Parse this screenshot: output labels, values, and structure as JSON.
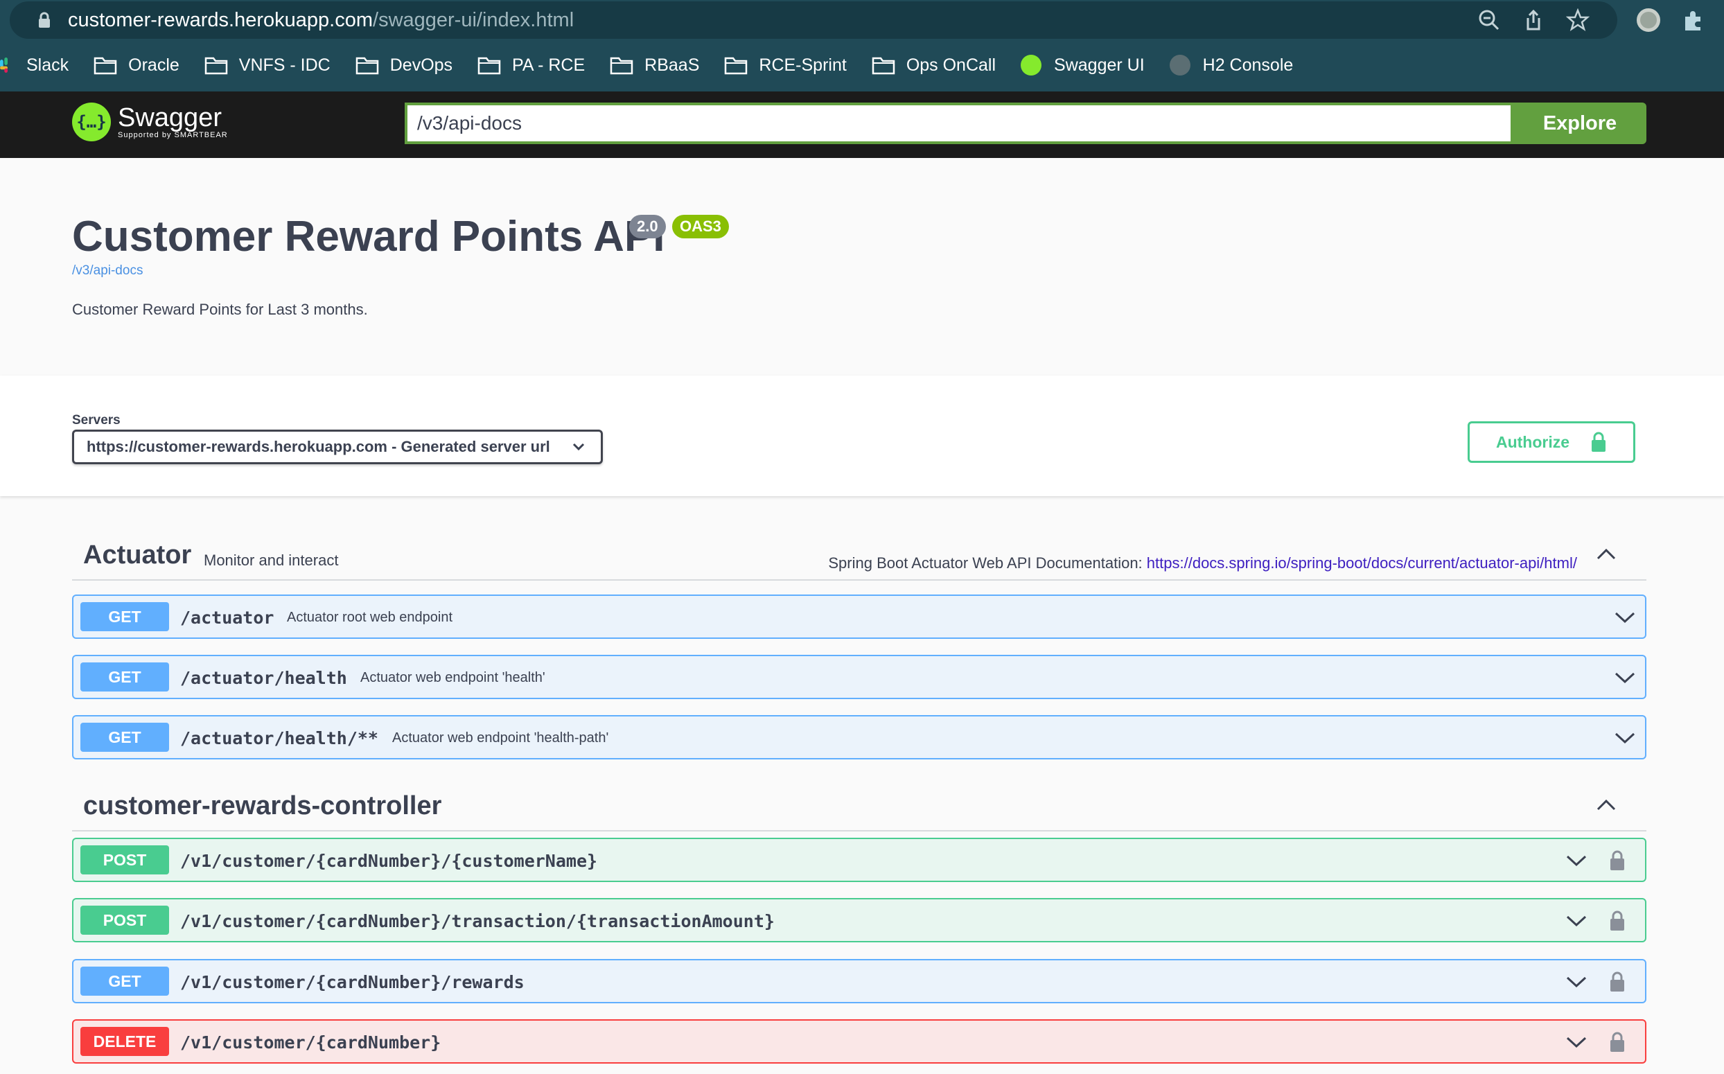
{
  "browser": {
    "url_host": "customer-rewards.herokuapp.com",
    "url_path": "/swagger-ui/index.html",
    "bookmarks": [
      {
        "label": "Slack",
        "icon": "slack-icon"
      },
      {
        "label": "Oracle",
        "icon": "folder-icon"
      },
      {
        "label": "VNFS - IDC",
        "icon": "folder-icon"
      },
      {
        "label": "DevOps",
        "icon": "folder-icon"
      },
      {
        "label": "PA - RCE",
        "icon": "folder-icon"
      },
      {
        "label": "RBaaS",
        "icon": "folder-icon"
      },
      {
        "label": "RCE-Sprint",
        "icon": "folder-icon"
      },
      {
        "label": "Ops OnCall",
        "icon": "folder-icon"
      },
      {
        "label": "Swagger UI",
        "icon": "swagger-icon"
      },
      {
        "label": "H2 Console",
        "icon": "globe-icon"
      }
    ]
  },
  "topbar": {
    "brand": "Swagger",
    "supported_by": "Supported by SMARTBEAR",
    "spec_url": "/v3/api-docs",
    "explore_label": "Explore"
  },
  "info": {
    "title": "Customer Reward Points API",
    "version": "2.0",
    "oas_badge": "OAS3",
    "spec_link": "/v3/api-docs",
    "description": "Customer Reward Points for Last 3 months."
  },
  "servers": {
    "label": "Servers",
    "selected": "https://customer-rewards.herokuapp.com - Generated server url",
    "authorize_label": "Authorize"
  },
  "tags": [
    {
      "name": "Actuator",
      "description": "Monitor and interact",
      "external_text": "Spring Boot Actuator Web API Documentation: ",
      "external_url": "https://docs.spring.io/spring-boot/docs/current/actuator-api/html/",
      "operations": [
        {
          "method": "GET",
          "path": "/actuator",
          "summary": "Actuator root web endpoint"
        },
        {
          "method": "GET",
          "path": "/actuator/health",
          "summary": "Actuator web endpoint 'health'"
        },
        {
          "method": "GET",
          "path": "/actuator/health/**",
          "summary": "Actuator web endpoint 'health-path'"
        }
      ]
    },
    {
      "name": "customer-rewards-controller",
      "operations": [
        {
          "method": "POST",
          "path": "/v1/customer/{cardNumber}/{customerName}"
        },
        {
          "method": "POST",
          "path": "/v1/customer/{cardNumber}/transaction/{transactionAmount}"
        },
        {
          "method": "GET",
          "path": "/v1/customer/{cardNumber}/rewards"
        },
        {
          "method": "DELETE",
          "path": "/v1/customer/{cardNumber}"
        }
      ]
    }
  ],
  "colors": {
    "get": "#61affe",
    "post": "#49cc90",
    "delete": "#f93e3e",
    "swagger_green": "#62a03f"
  }
}
